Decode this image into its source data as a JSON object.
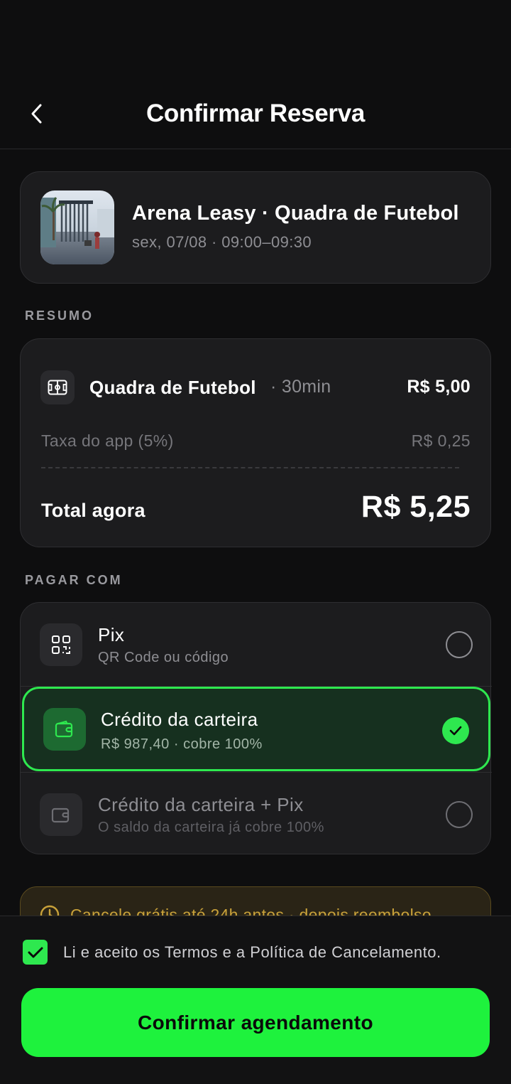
{
  "header": {
    "title": "Confirmar Reserva",
    "back_icon": "chevron-left-icon"
  },
  "venue": {
    "name": "Arena Leasy · Quadra de Futebol",
    "date_time": "sex, 07/08 · 09:00–09:30"
  },
  "summary": {
    "section_label": "RESUMO",
    "item_name": "Quadra de Futebol",
    "item_duration": "· 30min",
    "item_price": "R$ 5,00",
    "fee_label": "Taxa do app (5%)",
    "fee_value": "R$ 0,25",
    "total_label": "Total agora",
    "total_value": "R$ 5,25"
  },
  "payment": {
    "section_label": "PAGAR COM",
    "options": [
      {
        "title": "Pix",
        "subtitle": "QR Code ou código",
        "selected": false,
        "icon": "qr-code-icon"
      },
      {
        "title": "Crédito da carteira",
        "subtitle": "R$ 987,40 · cobre 100%",
        "selected": true,
        "icon": "wallet-icon"
      },
      {
        "title": "Crédito da carteira + Pix",
        "subtitle": "O saldo da carteira já cobre 100%",
        "selected": false,
        "icon": "wallet-icon"
      }
    ]
  },
  "notice": {
    "text": "Cancele grátis até 24h antes · depois reembolso"
  },
  "footer": {
    "terms_text": "Li e aceito os Termos e a Política de Cancelamento.",
    "terms_checked": true,
    "confirm_label": "Confirmar agendamento"
  },
  "colors": {
    "accent": "#1ef23d",
    "background": "#0e0e0f",
    "card": "#1c1c1e",
    "selected_bg": "#16301f"
  }
}
